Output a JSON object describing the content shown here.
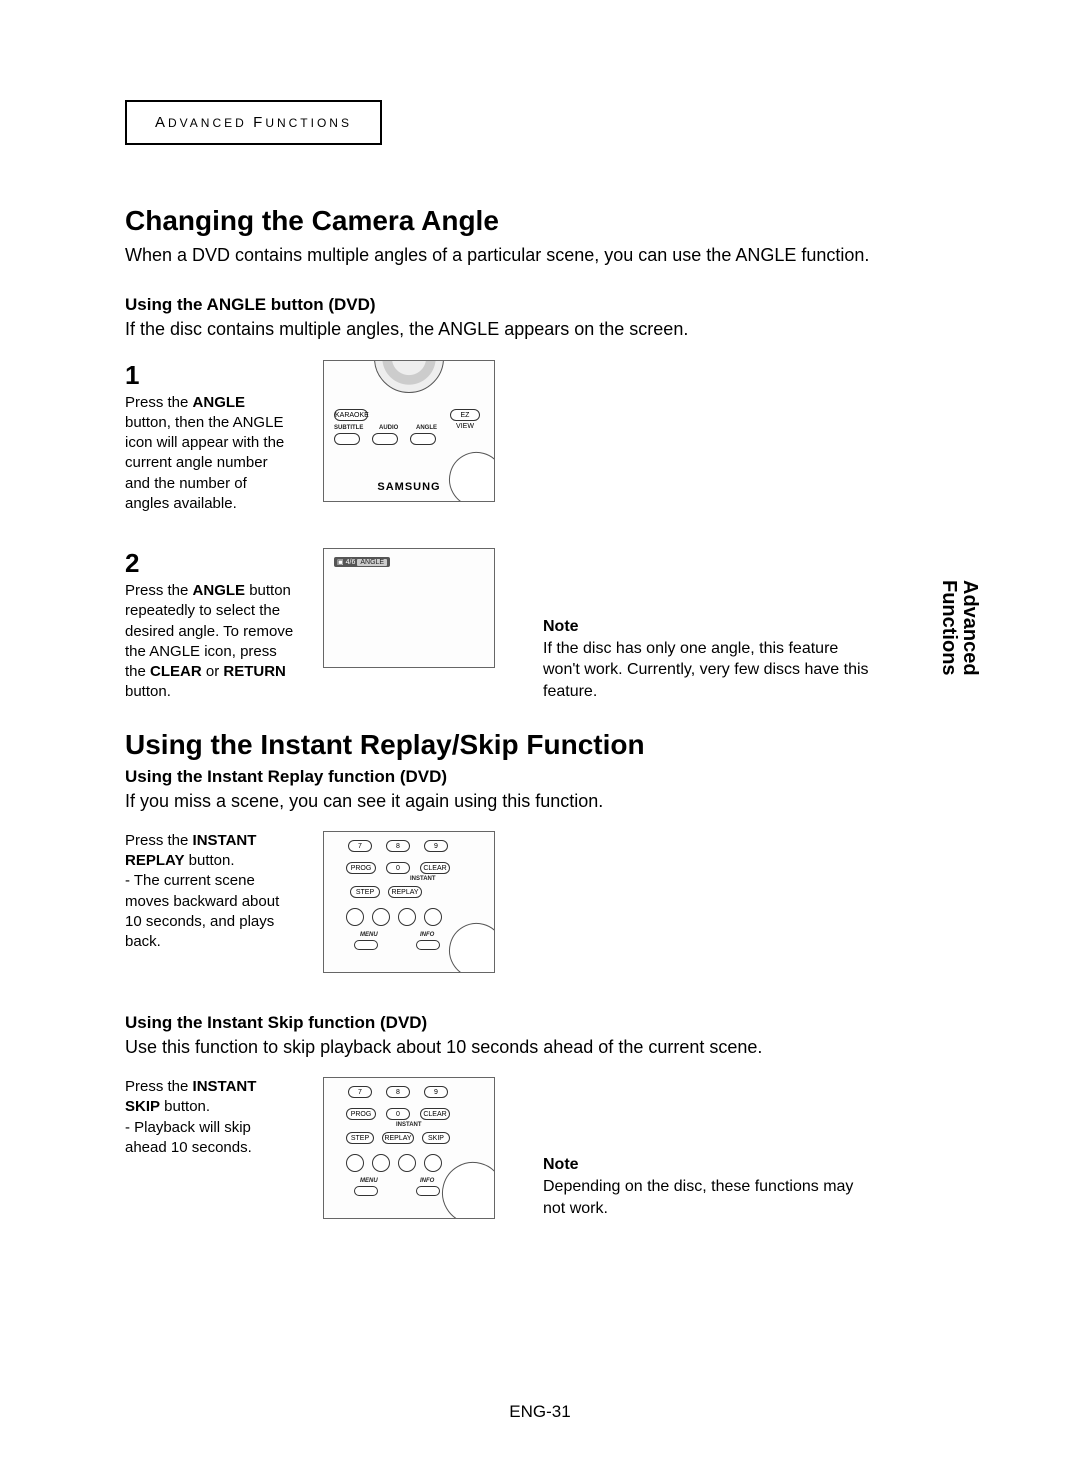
{
  "chapter_label_a": "A",
  "chapter_label_rest": "DVANCED ",
  "chapter_label_f": "F",
  "chapter_label_rest2": "UNCTIONS",
  "side_tab_l1": "Advanced",
  "side_tab_l2": "Functions",
  "page_number": "ENG-31",
  "s1": {
    "h": "Changing the Camera Angle",
    "lead": "When a DVD contains multiple angles of a particular scene, you can use the ANGLE function.",
    "sub": "Using the ANGLE button (DVD)",
    "desc": "If the disc contains multiple angles, the ANGLE appears on the screen.",
    "step1_num": "1",
    "step1_a": "Press the ",
    "step1_b": "ANGLE",
    "step1_c": " button, then the ANGLE icon will appear with the current angle number and the number of angles available.",
    "step2_num": "2",
    "step2_a": "Press the ",
    "step2_b": "ANGLE",
    "step2_c": " button repeatedly to select the desired angle. To remove the ANGLE icon, press the ",
    "step2_d": "CLEAR",
    "step2_e": " or ",
    "step2_f": "RETURN",
    "step2_g": " button.",
    "note_h": "Note",
    "note_t": "If the disc has only one angle, this feature won't work. Currently, very few discs have this feature.",
    "osd_ratio": "4/6",
    "osd_tag": "ANGLE",
    "remote_brand": "SAMSUNG",
    "btn_karaoke": "KARAOKE",
    "btn_ezview": "EZ VIEW",
    "btn_subtitle": "SUBTITLE",
    "btn_audio": "AUDIO",
    "btn_angle": "ANGLE"
  },
  "s2": {
    "h": "Using the Instant Replay/Skip Function",
    "sub1": "Using the Instant Replay function (DVD)",
    "desc1": "If you miss a scene, you can see it again using this function.",
    "replay_a": "Press the ",
    "replay_b": "INSTANT REPLAY",
    "replay_c": " button.",
    "replay_d": "- The current scene moves backward about 10 seconds, and plays back.",
    "sub2": "Using the Instant Skip function (DVD)",
    "desc2": "Use this function to skip playback about 10 seconds ahead of the current scene.",
    "skip_a": "Press the ",
    "skip_b": "INSTANT SKIP",
    "skip_c": " button.",
    "skip_d": "- Playback will skip ahead 10 seconds.",
    "note_h": "Note",
    "note_t": "Depending on the disc, these functions may not work.",
    "btn_7": "7",
    "btn_8": "8",
    "btn_9": "9",
    "btn_0": "0",
    "btn_prog": "PROG",
    "btn_clear": "CLEAR",
    "btn_step": "STEP",
    "btn_replay": "REPLAY",
    "btn_skip": "SKIP",
    "btn_instant": "INSTANT",
    "btn_menu": "MENU",
    "btn_info": "INFO"
  }
}
